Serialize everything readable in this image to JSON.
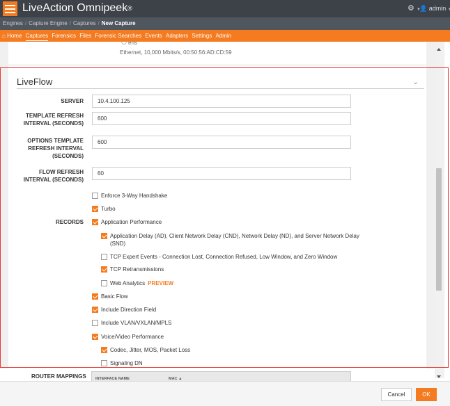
{
  "header": {
    "logo_text": "LiveAction Omnipeek",
    "logo_mark": "®",
    "user": "admin"
  },
  "breadcrumb": {
    "items": [
      "Engines",
      "Capture Engine",
      "Captures"
    ],
    "current": "New Capture"
  },
  "nav": {
    "items": [
      "Home",
      "Captures",
      "Forensics",
      "Files",
      "Forensic Searches",
      "Events",
      "Adapters",
      "Settings",
      "Admin"
    ],
    "active": "Captures"
  },
  "adapter": {
    "name": "ens",
    "description": "Ethernet, 10,000 Mbits/s, 00:50:56:AD:CD:59"
  },
  "section": {
    "title": "LiveFlow"
  },
  "fields": {
    "server": {
      "label": "SERVER",
      "value": "10.4.100.125"
    },
    "template_refresh": {
      "label_1": "TEMPLATE REFRESH",
      "label_2": "INTERVAL (SECONDS)",
      "value": "600"
    },
    "options_template": {
      "label_1": "OPTIONS TEMPLATE",
      "label_2": "REFRESH INTERVAL",
      "label_3": "(SECONDS)",
      "value": "600"
    },
    "flow_refresh": {
      "label_1": "FLOW REFRESH",
      "label_2": "INTERVAL (SECONDS)",
      "value": "60"
    }
  },
  "records_label": "RECORDS",
  "checkboxes": {
    "enforce_3way": {
      "label": "Enforce 3-Way Handshake",
      "checked": false
    },
    "turbo": {
      "label": "Turbo",
      "checked": true
    },
    "app_performance": {
      "label": "Application Performance",
      "checked": true
    },
    "app_delay": {
      "label_1": "Application Delay (AD), Client Network Delay (CND), Network Delay (ND), and Server Network Delay",
      "label_2": "(SND)",
      "checked": true
    },
    "tcp_expert": {
      "label": "TCP Expert Events - Connection Lost, Connection Refused, Low Window, and Zero Window",
      "checked": false
    },
    "tcp_retrans": {
      "label": "TCP Retransmissions",
      "checked": true
    },
    "web_analytics": {
      "label": "Web Analytics",
      "badge": "PREVIEW",
      "checked": false
    },
    "basic_flow": {
      "label": "Basic Flow",
      "checked": true
    },
    "direction_field": {
      "label": "Include Direction Field",
      "checked": true
    },
    "vlan": {
      "label": "Include VLAN/VXLAN/MPLS",
      "checked": false
    },
    "voice_video": {
      "label": "Voice/Video Performance",
      "checked": true
    },
    "codec": {
      "label": "Codec, Jitter, MOS, Packet Loss",
      "checked": true
    },
    "signaling_dn": {
      "label": "Signaling DN",
      "checked": false
    }
  },
  "router_mappings": {
    "label": "ROUTER MAPPINGS",
    "columns": [
      "INTERFACE NAME",
      "MAC"
    ],
    "sort_indicator": "▲"
  },
  "footer": {
    "cancel": "Cancel",
    "ok": "OK"
  },
  "colors": {
    "accent": "#f47b20",
    "topbar": "#3c4248",
    "breadcrumb_bg": "#4f565e",
    "highlight_border": "#e53935"
  }
}
